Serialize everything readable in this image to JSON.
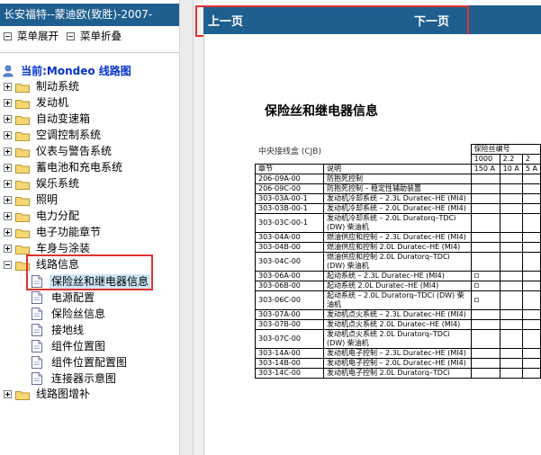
{
  "app": {
    "title": "长安福特--蒙迪欧(致胜)-2007-"
  },
  "menu": {
    "expand": "菜单展开",
    "collapse": "菜单折叠"
  },
  "tree": {
    "root": "当前:Mondeo 线路图",
    "categories": [
      {
        "label": "制动系统",
        "expanded": false
      },
      {
        "label": "发动机",
        "expanded": false
      },
      {
        "label": "自动变速箱",
        "expanded": false
      },
      {
        "label": "空调控制系统",
        "expanded": false
      },
      {
        "label": "仪表与警告系统",
        "expanded": false
      },
      {
        "label": "蓄电池和充电系统",
        "expanded": false
      },
      {
        "label": "娱乐系统",
        "expanded": false
      },
      {
        "label": "照明",
        "expanded": false
      },
      {
        "label": "电力分配",
        "expanded": false
      },
      {
        "label": "电子功能章节",
        "expanded": false
      },
      {
        "label": "车身与涂装",
        "expanded": false
      },
      {
        "label": "线路信息",
        "expanded": true
      },
      {
        "label": "线路图增补",
        "expanded": false
      }
    ],
    "children": [
      "保险丝和继电器信息",
      "电源配置",
      "保险丝信息",
      "接地线",
      "组件位置图",
      "组件位置配置图",
      "连接器示意图"
    ],
    "selected_child": "保险丝和继电器信息"
  },
  "nav": {
    "prev": "上一页",
    "next": "下一页"
  },
  "document": {
    "title": "保险丝和继电器信息",
    "subtitle": "中央接线盒 (CJB)",
    "table": {
      "group_header": "保险丝编号",
      "fuse_numbers": [
        "1000",
        "2.2",
        "2"
      ],
      "fuse_ratings": [
        "150 A",
        "10 A",
        "5 A"
      ],
      "col_headers": [
        "章节",
        "说明"
      ],
      "rows": [
        {
          "section": "206-09A-00",
          "desc": "防抱死控制",
          "mark": false
        },
        {
          "section": "206-09C-00",
          "desc": "防抱死控制 – 稳定性辅助装置",
          "mark": false
        },
        {
          "section": "303-03A-00-1",
          "desc": "发动机冷却系统 – 2.3L Duratec–HE (MI4)",
          "mark": false
        },
        {
          "section": "303-03B-00-1",
          "desc": "发动机冷却系统 – 2.0L Duratec–HE (MI4)",
          "mark": false
        },
        {
          "section": "303-03C-00-1",
          "desc": "发动机冷却系统 – 2.0L Duratorq–TDCi (DW) 柴油机",
          "mark": false
        },
        {
          "section": "303-04A-00",
          "desc": "燃油供应和控制 – 2.3L Duratec–HE (MI4)",
          "mark": false
        },
        {
          "section": "303-04B-00",
          "desc": "燃油供应和控制 2.0L Duratec–HE (MI4)",
          "mark": false
        },
        {
          "section": "303-04C-00",
          "desc": "燃油供应和控制 2.0L Duratorq–TDCi (DW) 柴油机",
          "mark": false
        },
        {
          "section": "303-06A-00",
          "desc": "起动系统 – 2.3L Duratec–HE (MI4)",
          "mark": true
        },
        {
          "section": "303-06B-00",
          "desc": "起动系统 2.0L Duratec–HE (MI4)",
          "mark": true
        },
        {
          "section": "303-06C-00",
          "desc": "起动系统 – 2.0L Duratorq–TDCi (DW) 柴油机",
          "mark": true
        },
        {
          "section": "303-07A-00",
          "desc": "发动机点火系统 – 2.3L Duratec–HE (MI4)",
          "mark": false
        },
        {
          "section": "303-07B-00",
          "desc": "发动机点火系统 2.0L Duratec–HE (MI4)",
          "mark": false
        },
        {
          "section": "303-07C-00",
          "desc": "发动机点火系统 2.0L Duratorq–TDCi (DW) 柴油机",
          "mark": false
        },
        {
          "section": "303-14A-00",
          "desc": "发动机电子控制 – 2.3L Duratec–HE (MI4)",
          "mark": false
        },
        {
          "section": "303-14B-00",
          "desc": "发动机电子控制 – 2.0L Duratec–HE (MI4)",
          "mark": false
        },
        {
          "section": "303-14C-00",
          "desc": "发动机电子控制 2.0L Duratorq–TDCi",
          "mark": false
        }
      ]
    }
  }
}
